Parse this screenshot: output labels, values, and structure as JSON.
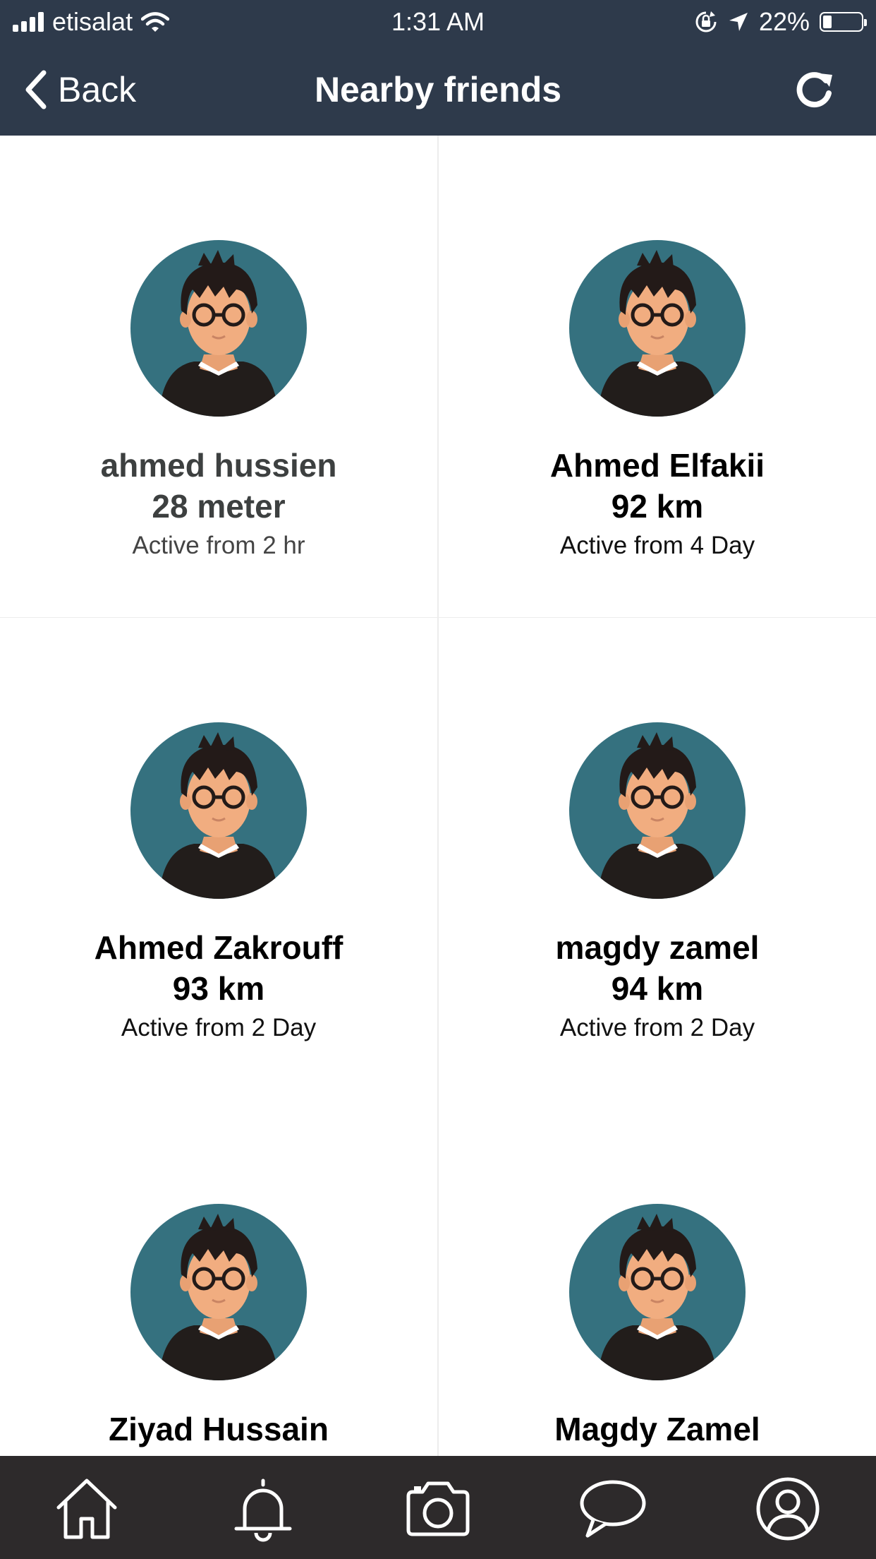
{
  "status_bar": {
    "carrier": "etisalat",
    "time": "1:31 AM",
    "battery": "22%",
    "battery_level": 0.22
  },
  "nav": {
    "back_label": "Back",
    "title": "Nearby friends",
    "refresh_icon": "refresh-icon"
  },
  "friends": [
    {
      "name": "ahmed hussien",
      "distance": "28 meter",
      "active": "Active from 2 hr"
    },
    {
      "name": "Ahmed Elfakii",
      "distance": "92 km",
      "active": "Active from 4 Day"
    },
    {
      "name": "Ahmed Zakrouff",
      "distance": "93 km",
      "active": "Active from 2 Day"
    },
    {
      "name": "magdy zamel",
      "distance": "94 km",
      "active": "Active from 2 Day"
    },
    {
      "name": "Ziyad Hussain",
      "distance": "",
      "active": ""
    },
    {
      "name": "Magdy Zamel",
      "distance": "",
      "active": ""
    }
  ],
  "tab_bar": {
    "tabs": [
      "home-icon",
      "bell-icon",
      "camera-icon",
      "chat-icon",
      "profile-icon"
    ]
  },
  "colors": {
    "header_bg": "#2e3a4b",
    "tabbar_bg": "#2d2a2b",
    "avatar_bg": "#35717f"
  }
}
